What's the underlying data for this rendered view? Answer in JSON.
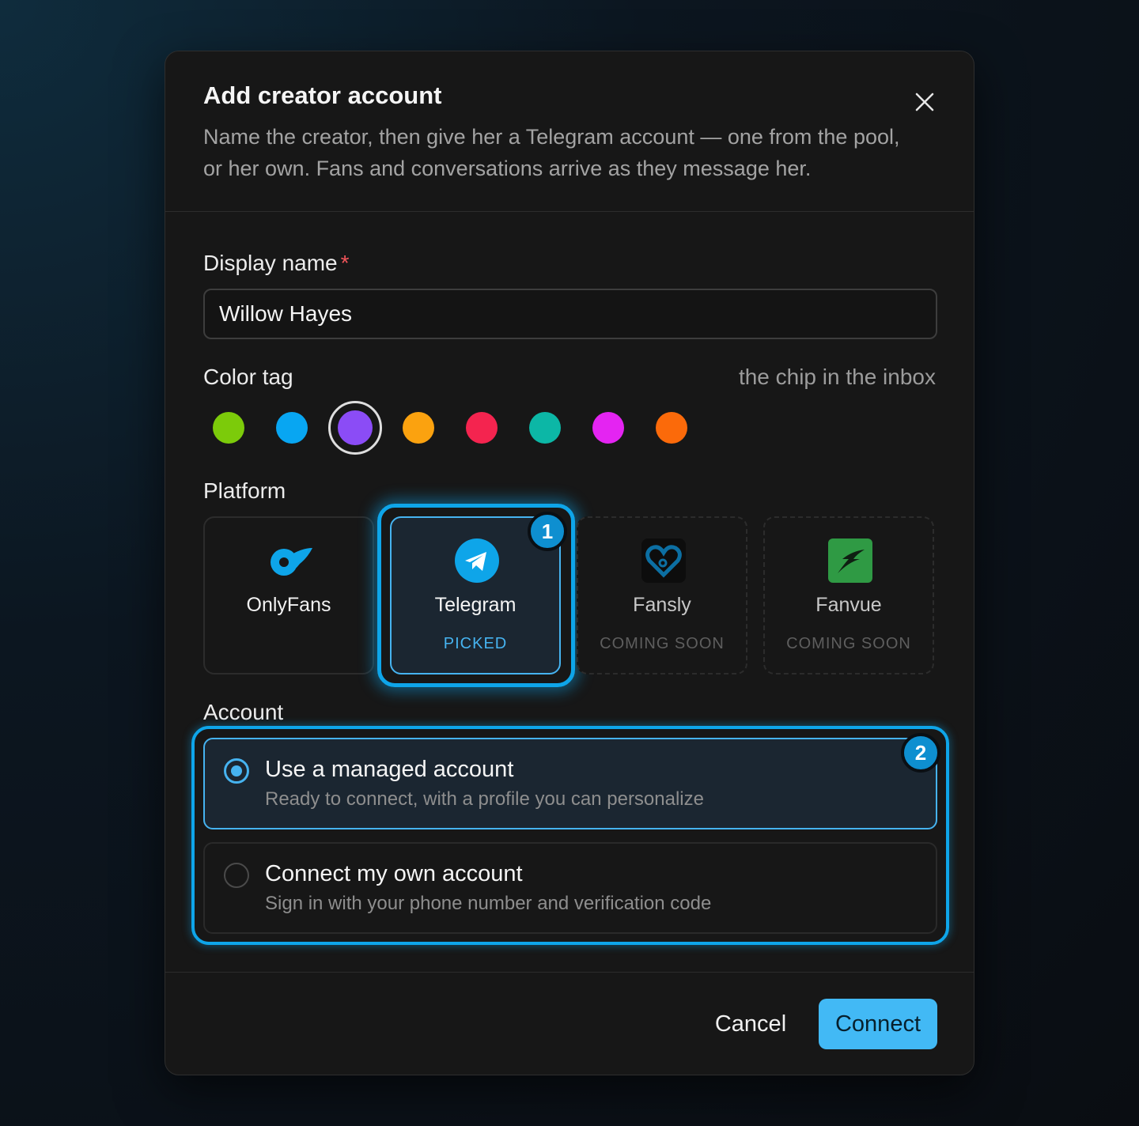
{
  "dialog": {
    "title": "Add creator account",
    "subtitle": "Name the creator, then give her a Telegram account — one from the pool, or her own. Fans and conversations arrive as they message her."
  },
  "display_name": {
    "label": "Display name",
    "required_mark": "*",
    "value": "Willow Hayes"
  },
  "color_tag": {
    "label": "Color tag",
    "hint": "the chip in the inbox",
    "selected": "#8b4cf6",
    "colors": [
      "#7ccb0a",
      "#08a6f2",
      "#8b4cf6",
      "#fba20f",
      "#f4244f",
      "#0cb7a6",
      "#e424f2",
      "#fb6a0a"
    ]
  },
  "platform": {
    "label": "Platform",
    "options": [
      {
        "name": "OnlyFans",
        "status": "",
        "icon": "onlyfans-icon"
      },
      {
        "name": "Telegram",
        "status": "PICKED",
        "icon": "telegram-icon"
      },
      {
        "name": "Fansly",
        "status": "COMING SOON",
        "icon": "fansly-icon"
      },
      {
        "name": "Fanvue",
        "status": "COMING SOON",
        "icon": "fanvue-icon"
      }
    ],
    "badge": "1"
  },
  "account": {
    "label": "Account",
    "badge": "2",
    "options": [
      {
        "title": "Use a managed account",
        "desc": "Ready to connect, with a profile you can personalize",
        "selected": true
      },
      {
        "title": "Connect my own account",
        "desc": "Sign in with your phone number and verification code",
        "selected": false
      }
    ]
  },
  "footer": {
    "cancel_label": "Cancel",
    "connect_label": "Connect"
  },
  "theme": {
    "accent": "#42b9f5",
    "highlight": "#0ea5e9"
  }
}
